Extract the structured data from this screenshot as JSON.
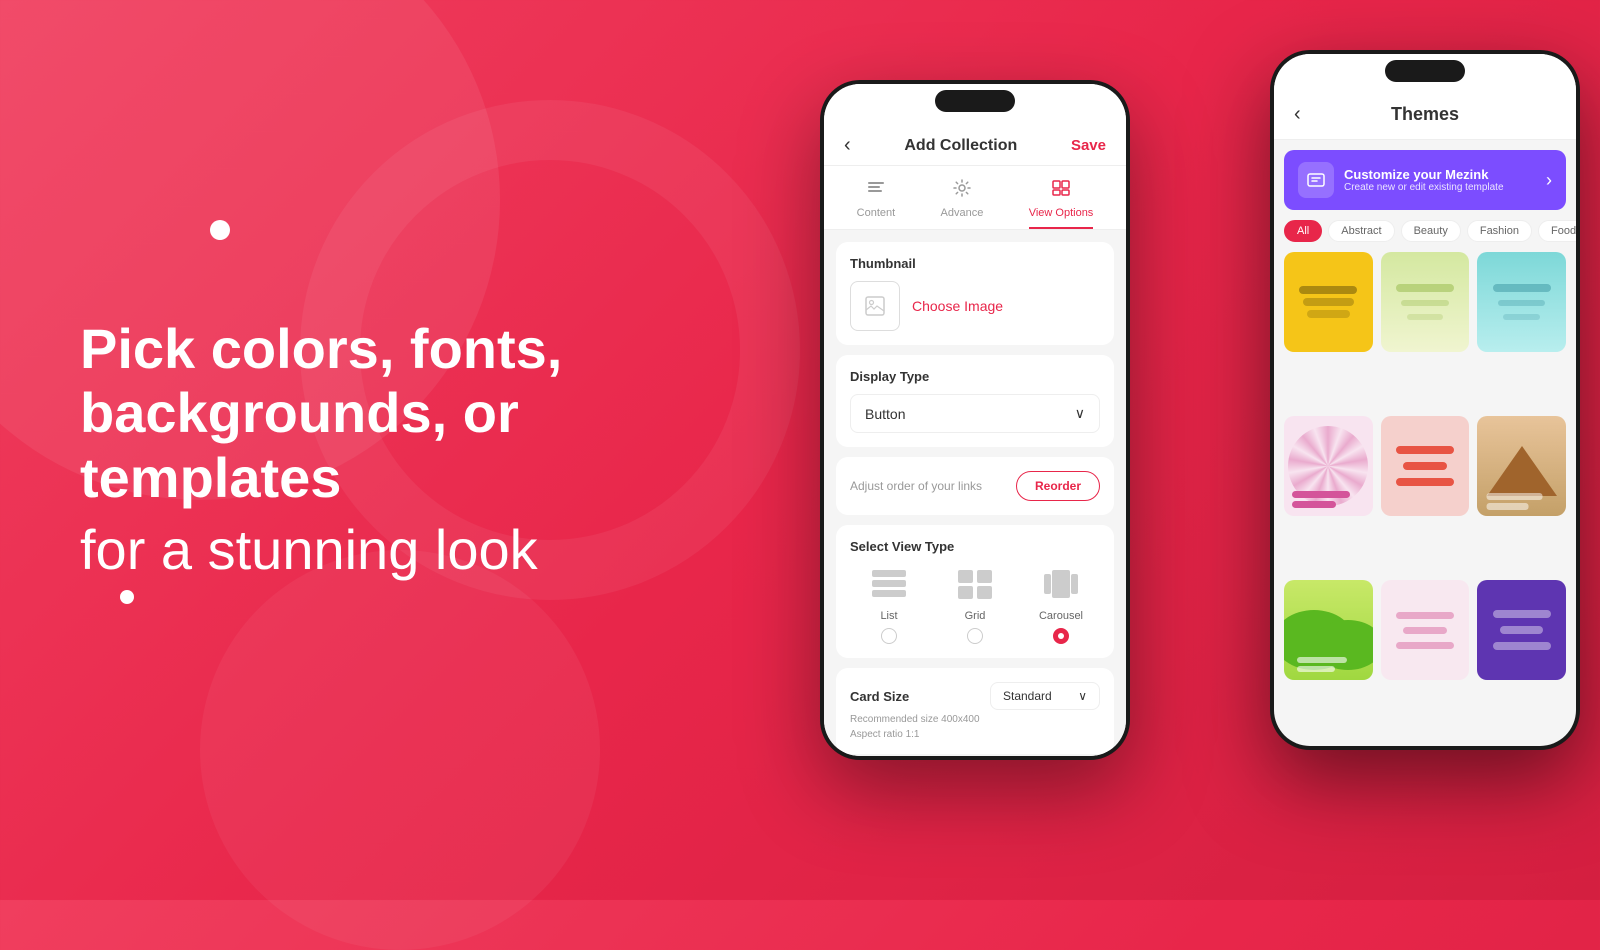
{
  "background": {
    "gradient_start": "#f03e5e",
    "gradient_end": "#d41f40"
  },
  "left_text": {
    "line1": "Pick colors, fonts,",
    "line2": "backgrounds, or templates",
    "line3": "for a stunning look"
  },
  "phone_back": {
    "title": "Add Collection",
    "save": "Save",
    "tabs": [
      {
        "label": "Content",
        "icon": "list-icon"
      },
      {
        "label": "Advance",
        "icon": "gear-icon"
      },
      {
        "label": "View Options",
        "icon": "view-icon"
      }
    ],
    "active_tab": "View Options",
    "thumbnail_label": "Thumbnail",
    "choose_image": "Choose Image",
    "display_type_label": "Display Type",
    "display_type_value": "Button",
    "reorder_text": "Adjust order of your links",
    "reorder_btn": "Reorder",
    "select_view_label": "Select View Type",
    "view_types": [
      {
        "label": "List",
        "selected": false
      },
      {
        "label": "Grid",
        "selected": false
      },
      {
        "label": "Carousel",
        "selected": true
      }
    ],
    "card_size_label": "Card Size",
    "card_size_value": "Standard",
    "rec_text1": "Recommended size 400x400",
    "rec_text2": "Aspect ratio 1:1"
  },
  "phone_front": {
    "title": "Themes",
    "back_btn": "‹",
    "banner_title": "Customize your Mezink",
    "banner_sub": "Create new or edit existing template",
    "filter_pills": [
      "All",
      "Abstract",
      "Beauty",
      "Fashion",
      "Food"
    ],
    "active_pill": "All"
  }
}
